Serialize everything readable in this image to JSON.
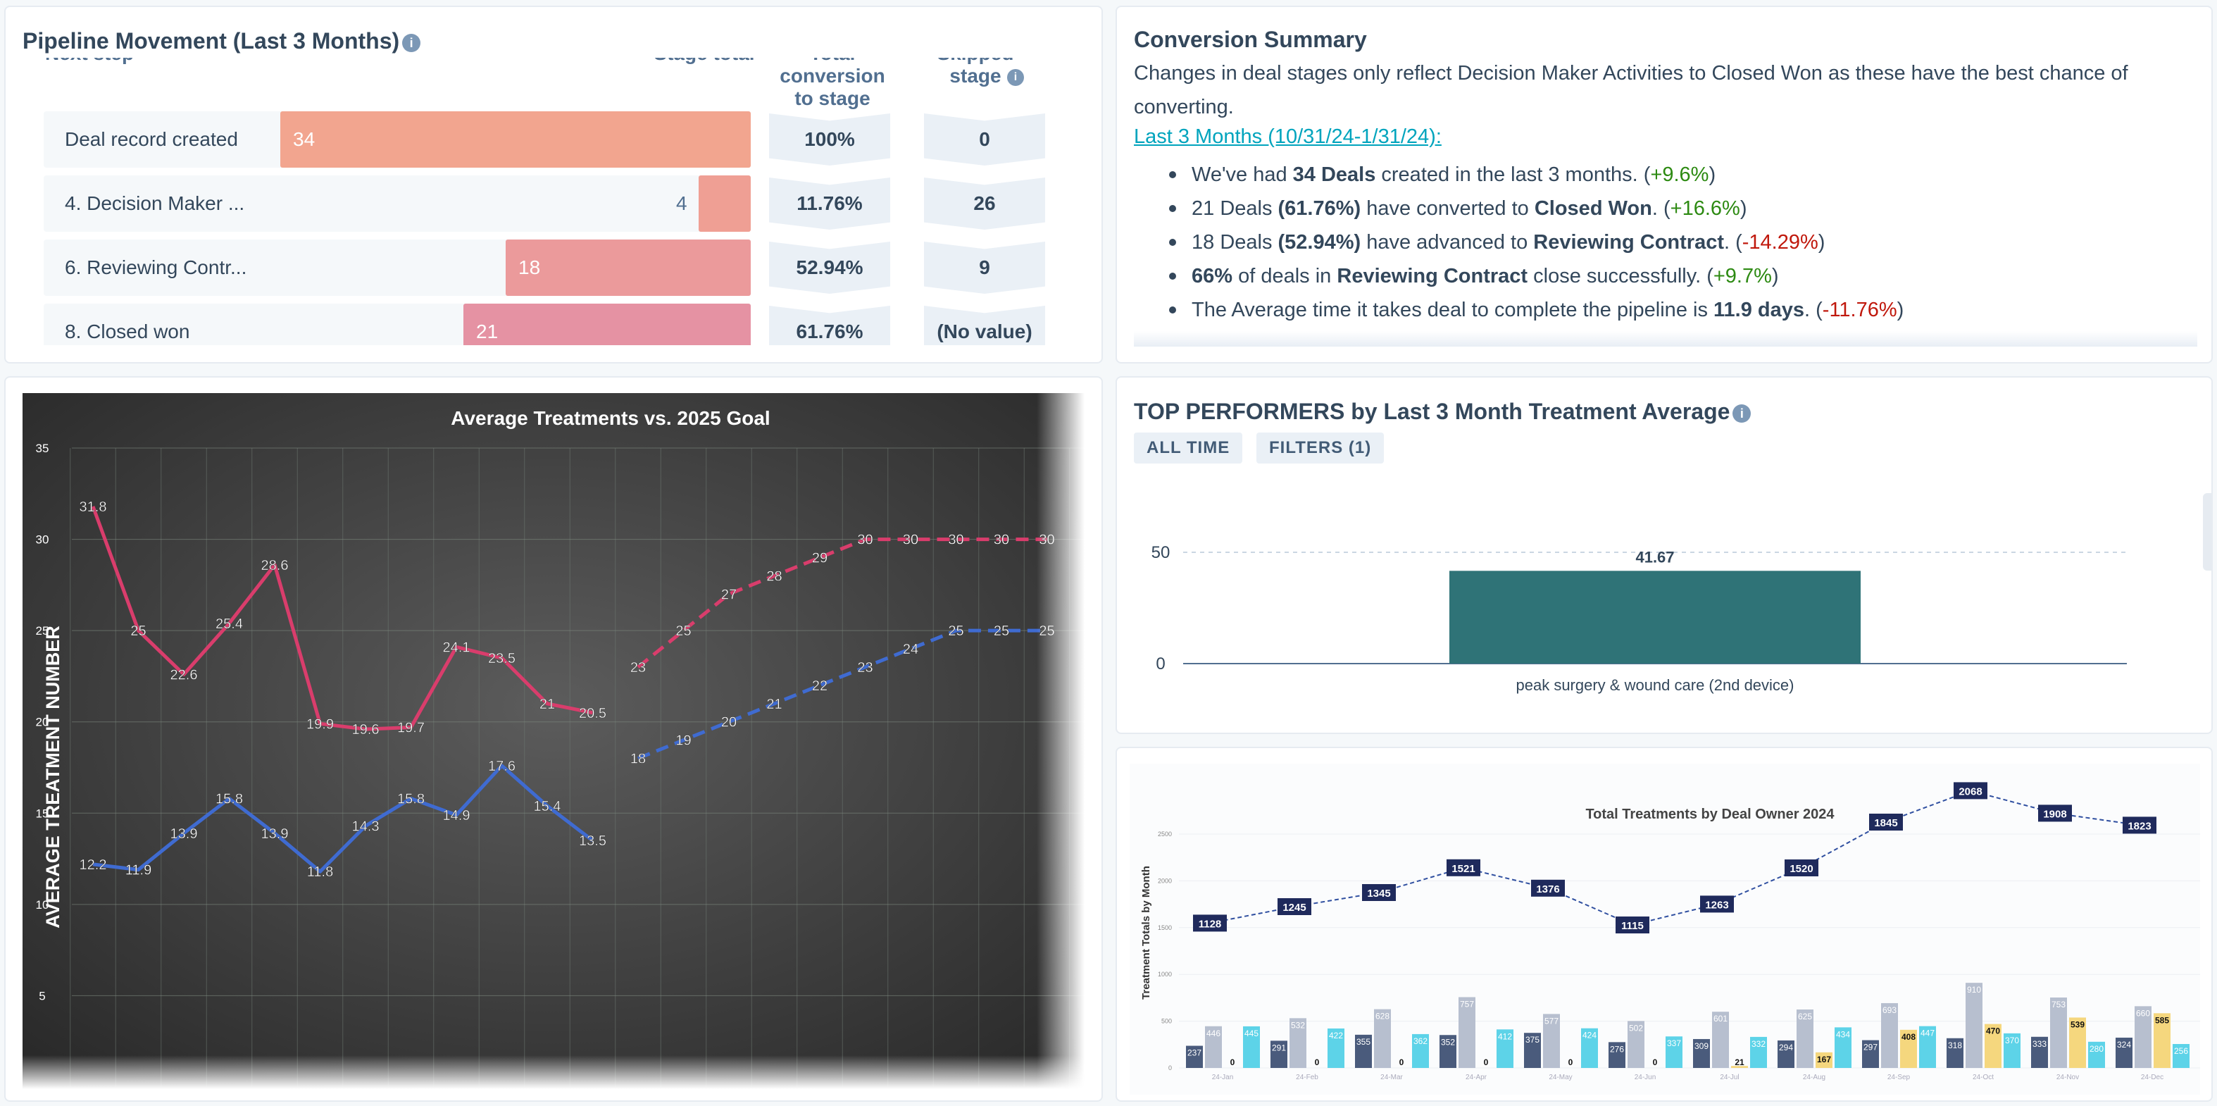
{
  "pipeline": {
    "title": "Pipeline Movement (Last 3 Months)",
    "info_icon": "info-icon",
    "headers": {
      "next_step": "Next step",
      "stage_total": "Stage total",
      "conversion": "Total conversion to stage",
      "skipped": "Skipped stage"
    },
    "rows": [
      {
        "label": "Deal record created",
        "value": "34",
        "conversion": "100%",
        "skipped": "0",
        "color": "#f2a58f"
      },
      {
        "label": "4. Decision Maker ...",
        "value": "4",
        "conversion": "11.76%",
        "skipped": "26",
        "color": "#ef9f94"
      },
      {
        "label": "6. Reviewing Contr...",
        "value": "18",
        "conversion": "52.94%",
        "skipped": "9",
        "color": "#eb9a9b"
      },
      {
        "label": "8. Closed won",
        "value": "21",
        "conversion": "61.76%",
        "skipped": "(No value)",
        "color": "#e592a3"
      }
    ]
  },
  "summary": {
    "title": "Conversion Summary",
    "intro": "Changes in deal stages only reflect Decision Maker Activities to Closed Won as these have the best chance of converting.",
    "link": "Last 3 Months (10/31/24-1/31/24):",
    "b1": {
      "pre": "We've had ",
      "bold": "34 Deals",
      "post": " created in the last 3 months. (",
      "delta": "+9.6%",
      "end": ")"
    },
    "b2": {
      "pre": "21 Deals ",
      "bold1": "(61.76%)",
      "mid": " have converted to ",
      "bold2": "Closed Won",
      "post": ". (",
      "delta": "+16.6%",
      "end": ")"
    },
    "b3": {
      "pre": "18 Deals ",
      "bold1": "(52.94%)",
      "mid": " have advanced to ",
      "bold2": "Reviewing Contract",
      "post": ". (",
      "delta": "-14.29%",
      "end": ")"
    },
    "b4": {
      "bold1": "66%",
      "mid": " of deals in ",
      "bold2": "Reviewing Contract",
      "post": " close successfully. (",
      "delta": "+9.7%",
      "end": ")"
    },
    "b5": {
      "pre": "The Average time it takes deal to complete the pipeline is ",
      "bold": "11.9 days",
      "post": ". (",
      "delta": "-11.76%",
      "end": ")"
    }
  },
  "top_performers": {
    "title": "TOP PERFORMERS by Last 3 Month Treatment Average",
    "chips": [
      "ALL TIME",
      "FILTERS (1)"
    ]
  },
  "colors": {
    "pink": "#d93d6c",
    "blue": "#3f6bd1",
    "teal": "#2f7377",
    "navy": "#1f2a5c"
  },
  "chart_data": [
    {
      "type": "line",
      "title": "Average Treatments vs. 2025 Goal",
      "ylabel": "AVERAGE TREATMENT NUMBER",
      "ylim": [
        0,
        35
      ],
      "yticks": [
        5,
        10,
        15,
        20,
        25,
        30,
        35
      ],
      "grid": true,
      "series": [
        {
          "color": "#d93d6c",
          "style": "solid",
          "x": [
            0,
            1,
            2,
            3,
            4,
            5,
            6,
            7,
            8,
            9,
            10,
            11
          ],
          "values": [
            31.8,
            25,
            22.6,
            25.4,
            28.6,
            19.9,
            19.6,
            19.7,
            24.1,
            23.5,
            21,
            20.5
          ]
        },
        {
          "color": "#3f6bd1",
          "style": "solid",
          "x": [
            0,
            1,
            2,
            3,
            4,
            5,
            6,
            7,
            8,
            9,
            10,
            11
          ],
          "values": [
            12.2,
            11.9,
            13.9,
            15.8,
            13.9,
            11.8,
            14.3,
            15.8,
            14.9,
            17.6,
            15.4,
            13.5
          ]
        },
        {
          "color": "#d93d6c",
          "style": "dashed",
          "x": [
            12,
            13,
            14,
            15,
            16,
            17,
            18,
            19,
            20,
            21
          ],
          "values": [
            23,
            25,
            27,
            28,
            29,
            30,
            30,
            30,
            30,
            30
          ]
        },
        {
          "color": "#3f6bd1",
          "style": "dashed",
          "x": [
            12,
            13,
            14,
            15,
            16,
            17,
            18,
            19,
            20,
            21
          ],
          "values": [
            18,
            19,
            20,
            21,
            22,
            23,
            24,
            25,
            25,
            25
          ]
        }
      ]
    },
    {
      "type": "bar",
      "categories": [
        "peak surgery & wound care (2nd device)"
      ],
      "values": [
        41.67
      ],
      "value_labels": [
        "41.67"
      ],
      "ylim": [
        0,
        50
      ],
      "yticks": [
        "0",
        "50"
      ],
      "color": "#2f7377"
    },
    {
      "type": "bar",
      "title": "Total Treatments by Deal Owner 2024",
      "ylabel": "Treatment Totals by Month",
      "categories": [
        "24-Jan",
        "24-Feb",
        "24-Mar",
        "24-Apr",
        "24-May",
        "24-Jun",
        "24-Jul",
        "24-Aug",
        "24-Sep",
        "24-Oct",
        "24-Nov",
        "24-Dec"
      ],
      "yticks": [
        "0",
        "500",
        "1000",
        "1500",
        "2000",
        "2500"
      ],
      "ylim": [
        0,
        2500
      ],
      "series": [
        {
          "color": "#4a5b7c",
          "values": [
            237,
            291,
            355,
            352,
            375,
            276,
            309,
            294,
            297,
            318,
            333,
            324
          ]
        },
        {
          "color": "#b7bfcf",
          "values": [
            446,
            532,
            628,
            757,
            577,
            502,
            601,
            625,
            693,
            910,
            753,
            660
          ]
        },
        {
          "color": "#f5d77e",
          "values": [
            0,
            0,
            0,
            0,
            0,
            0,
            21,
            167,
            408,
            470,
            539,
            585
          ]
        },
        {
          "color": "#5dd3e8",
          "values": [
            445,
            422,
            362,
            412,
            424,
            337,
            332,
            434,
            447,
            370,
            280,
            256
          ]
        }
      ],
      "total_series": {
        "color": "#1f2a5c",
        "style": "dashed",
        "values": [
          1128,
          1245,
          1345,
          1521,
          1376,
          1115,
          1263,
          1520,
          1845,
          2068,
          1908,
          1823
        ]
      }
    }
  ]
}
